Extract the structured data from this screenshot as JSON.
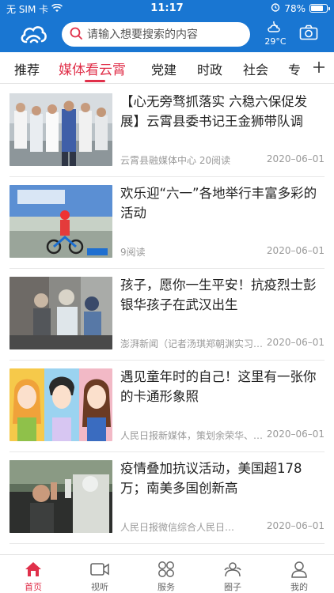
{
  "status_bar": {
    "carrier": "无 SIM 卡",
    "time": "11:17",
    "battery": "78%",
    "battery_level": 0.78
  },
  "header": {
    "search_placeholder": "请输入想要搜索的内容",
    "weather_temp": "29°C"
  },
  "tabs": [
    {
      "label": "推荐",
      "active": false
    },
    {
      "label": "媒体看云霄",
      "active": true
    },
    {
      "label": "党建",
      "active": false
    },
    {
      "label": "时政",
      "active": false
    },
    {
      "label": "社会",
      "active": false
    },
    {
      "label": "专",
      "active": false
    }
  ],
  "news": [
    {
      "title": "【心无旁骛抓落实 六稳六保促发展】云霄县委书记王金狮带队调研…",
      "source": "云霄县融媒体中心 20阅读",
      "date": "2020–06–01"
    },
    {
      "title": "欢乐迎“六一”各地举行丰富多彩的活动",
      "source": "9阅读",
      "date": "2020–06–01"
    },
    {
      "title": "孩子，愿你一生平安！抗疫烈士彭银华孩子在武汉出生",
      "source": "澎湃新闻（记者汤琪郑朝渊实习…",
      "date": "2020–06–01"
    },
    {
      "title": "遇见童年时的自己！这里有一张你的卡通形象照",
      "source": "人民日报新媒体，策划余荣华、…",
      "date": "2020–06–01"
    },
    {
      "title": "疫情叠加抗议活动，美国超178万；南美多国创新高",
      "source": "人民日报微信综合人民日…",
      "date": "2020–06–01"
    }
  ],
  "bottom_nav": [
    {
      "label": "首页",
      "active": true
    },
    {
      "label": "视听",
      "active": false
    },
    {
      "label": "服务",
      "active": false
    },
    {
      "label": "圈子",
      "active": false
    },
    {
      "label": "我的",
      "active": false
    }
  ],
  "colors": {
    "header_blue": "#1976d2",
    "accent_red": "#e0304a"
  },
  "icons": {
    "logo": "cloud-logo-icon",
    "search": "search-icon",
    "weather": "partly-cloudy-night-icon",
    "camera": "camera-icon",
    "plus": "plus-icon"
  }
}
